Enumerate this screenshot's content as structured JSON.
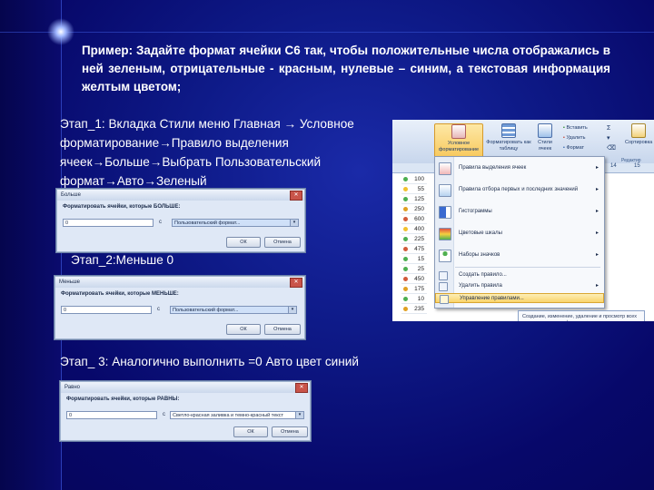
{
  "slide": {
    "task_text": "Пример: Задайте формат ячейки С6 так, чтобы положительные числа отображались в ней зеленым, отрицательные - красным, нулевые – синим, а текстовая информация желтым цветом;",
    "step1": {
      "line1": "Этап_1: Вкладка Стили меню Главная → Условное",
      "line2": "форматирование→Правило выделения",
      "line3": "ячеек→Больше→Выбрать Пользовательский",
      "line4": "формат→Авто→Зеленый"
    },
    "step2": "Этап_2:Меньше 0",
    "step3": "Этап_ 3: Аналогично выполнить =0  Авто цвет синий"
  },
  "dialog1": {
    "title": "Больше",
    "prompt": "Форматировать ячейки, которые БОЛЬШЕ:",
    "value": "0",
    "with_label": "с",
    "format": "Пользовательский формат...",
    "ok": "ОК",
    "cancel": "Отмена"
  },
  "dialog2": {
    "title": "Меньше",
    "prompt": "Форматировать ячейки, которые МЕНЬШЕ:",
    "value": "0",
    "with_label": "с",
    "format": "Пользовательский формат...",
    "ok": "ОК",
    "cancel": "Отмена"
  },
  "dialog3": {
    "title": "Равно",
    "prompt": "Форматировать ячейки, которые РАВНЫ:",
    "value": "0",
    "with_label": "с",
    "format": "Светло-красная заливка и темно-красный текст",
    "ok": "ОК",
    "cancel": "Отмена"
  },
  "excel": {
    "ribbon": {
      "cond_format": "Условное форматирование",
      "format_table": "Форматировать как таблицу",
      "cell_styles": "Стили ячеек",
      "insert": "Вставить",
      "delete": "Удалить",
      "format": "Формат",
      "sort": "Сортировка",
      "group": "Редактир"
    },
    "col_headers": [
      "14",
      "15"
    ],
    "cells": [
      {
        "v": "100",
        "c": "#4caf50"
      },
      {
        "v": "55",
        "c": "#f2c12e"
      },
      {
        "v": "125",
        "c": "#4caf50"
      },
      {
        "v": "250",
        "c": "#e0a022"
      },
      {
        "v": "600",
        "c": "#d35a3a"
      },
      {
        "v": "400",
        "c": "#f2c12e"
      },
      {
        "v": "225",
        "c": "#4caf50"
      },
      {
        "v": "475",
        "c": "#d35a3a"
      },
      {
        "v": "15",
        "c": "#4caf50"
      },
      {
        "v": "25",
        "c": "#4caf50"
      },
      {
        "v": "450",
        "c": "#d35a3a"
      },
      {
        "v": "175",
        "c": "#e0a022"
      },
      {
        "v": "10",
        "c": "#4caf50"
      },
      {
        "v": "235",
        "c": "#e0a022"
      }
    ],
    "menu": [
      {
        "label": "Правила выделения ячеек",
        "arrow": "▸"
      },
      {
        "label": "Правила отбора первых и последних значений",
        "arrow": "▸"
      },
      {
        "label": "Гистограммы",
        "arrow": "▸"
      },
      {
        "label": "Цветовые шкалы",
        "arrow": "▸"
      },
      {
        "label": "Наборы значков",
        "arrow": "▸"
      }
    ],
    "menu_small": [
      "Создать правило...",
      "Удалить правила",
      "Управление правилами..."
    ],
    "tooltip": "Создание, изменение, удаление и просмотр всех правил условного форматирования в книге с помощью диспетчера правил условного форматирования."
  }
}
